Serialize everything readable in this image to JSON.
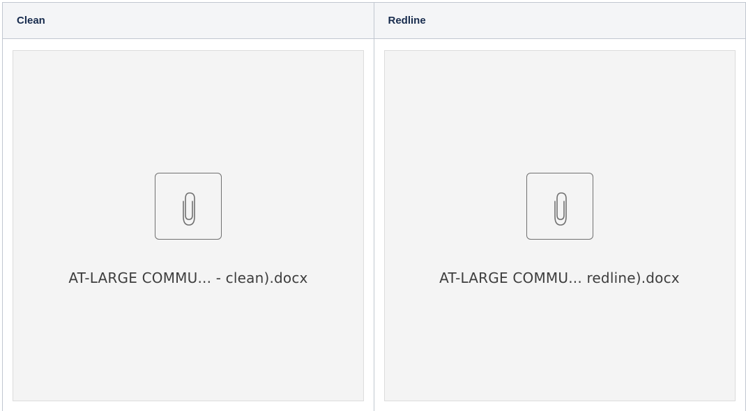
{
  "table": {
    "columns": [
      {
        "header": "Clean",
        "attachment": {
          "file_name": "AT-LARGE COMMU... - clean).docx",
          "icon": "paperclip-icon"
        }
      },
      {
        "header": "Redline",
        "attachment": {
          "file_name": "AT-LARGE COMMU... redline).docx",
          "icon": "paperclip-icon"
        }
      }
    ]
  },
  "colors": {
    "header_background": "#f4f5f7",
    "header_text": "#172b4d",
    "border": "#c1c7d0",
    "attachment_background": "#f4f4f4",
    "icon_stroke": "#707070",
    "file_name_text": "#3d3d3d"
  }
}
